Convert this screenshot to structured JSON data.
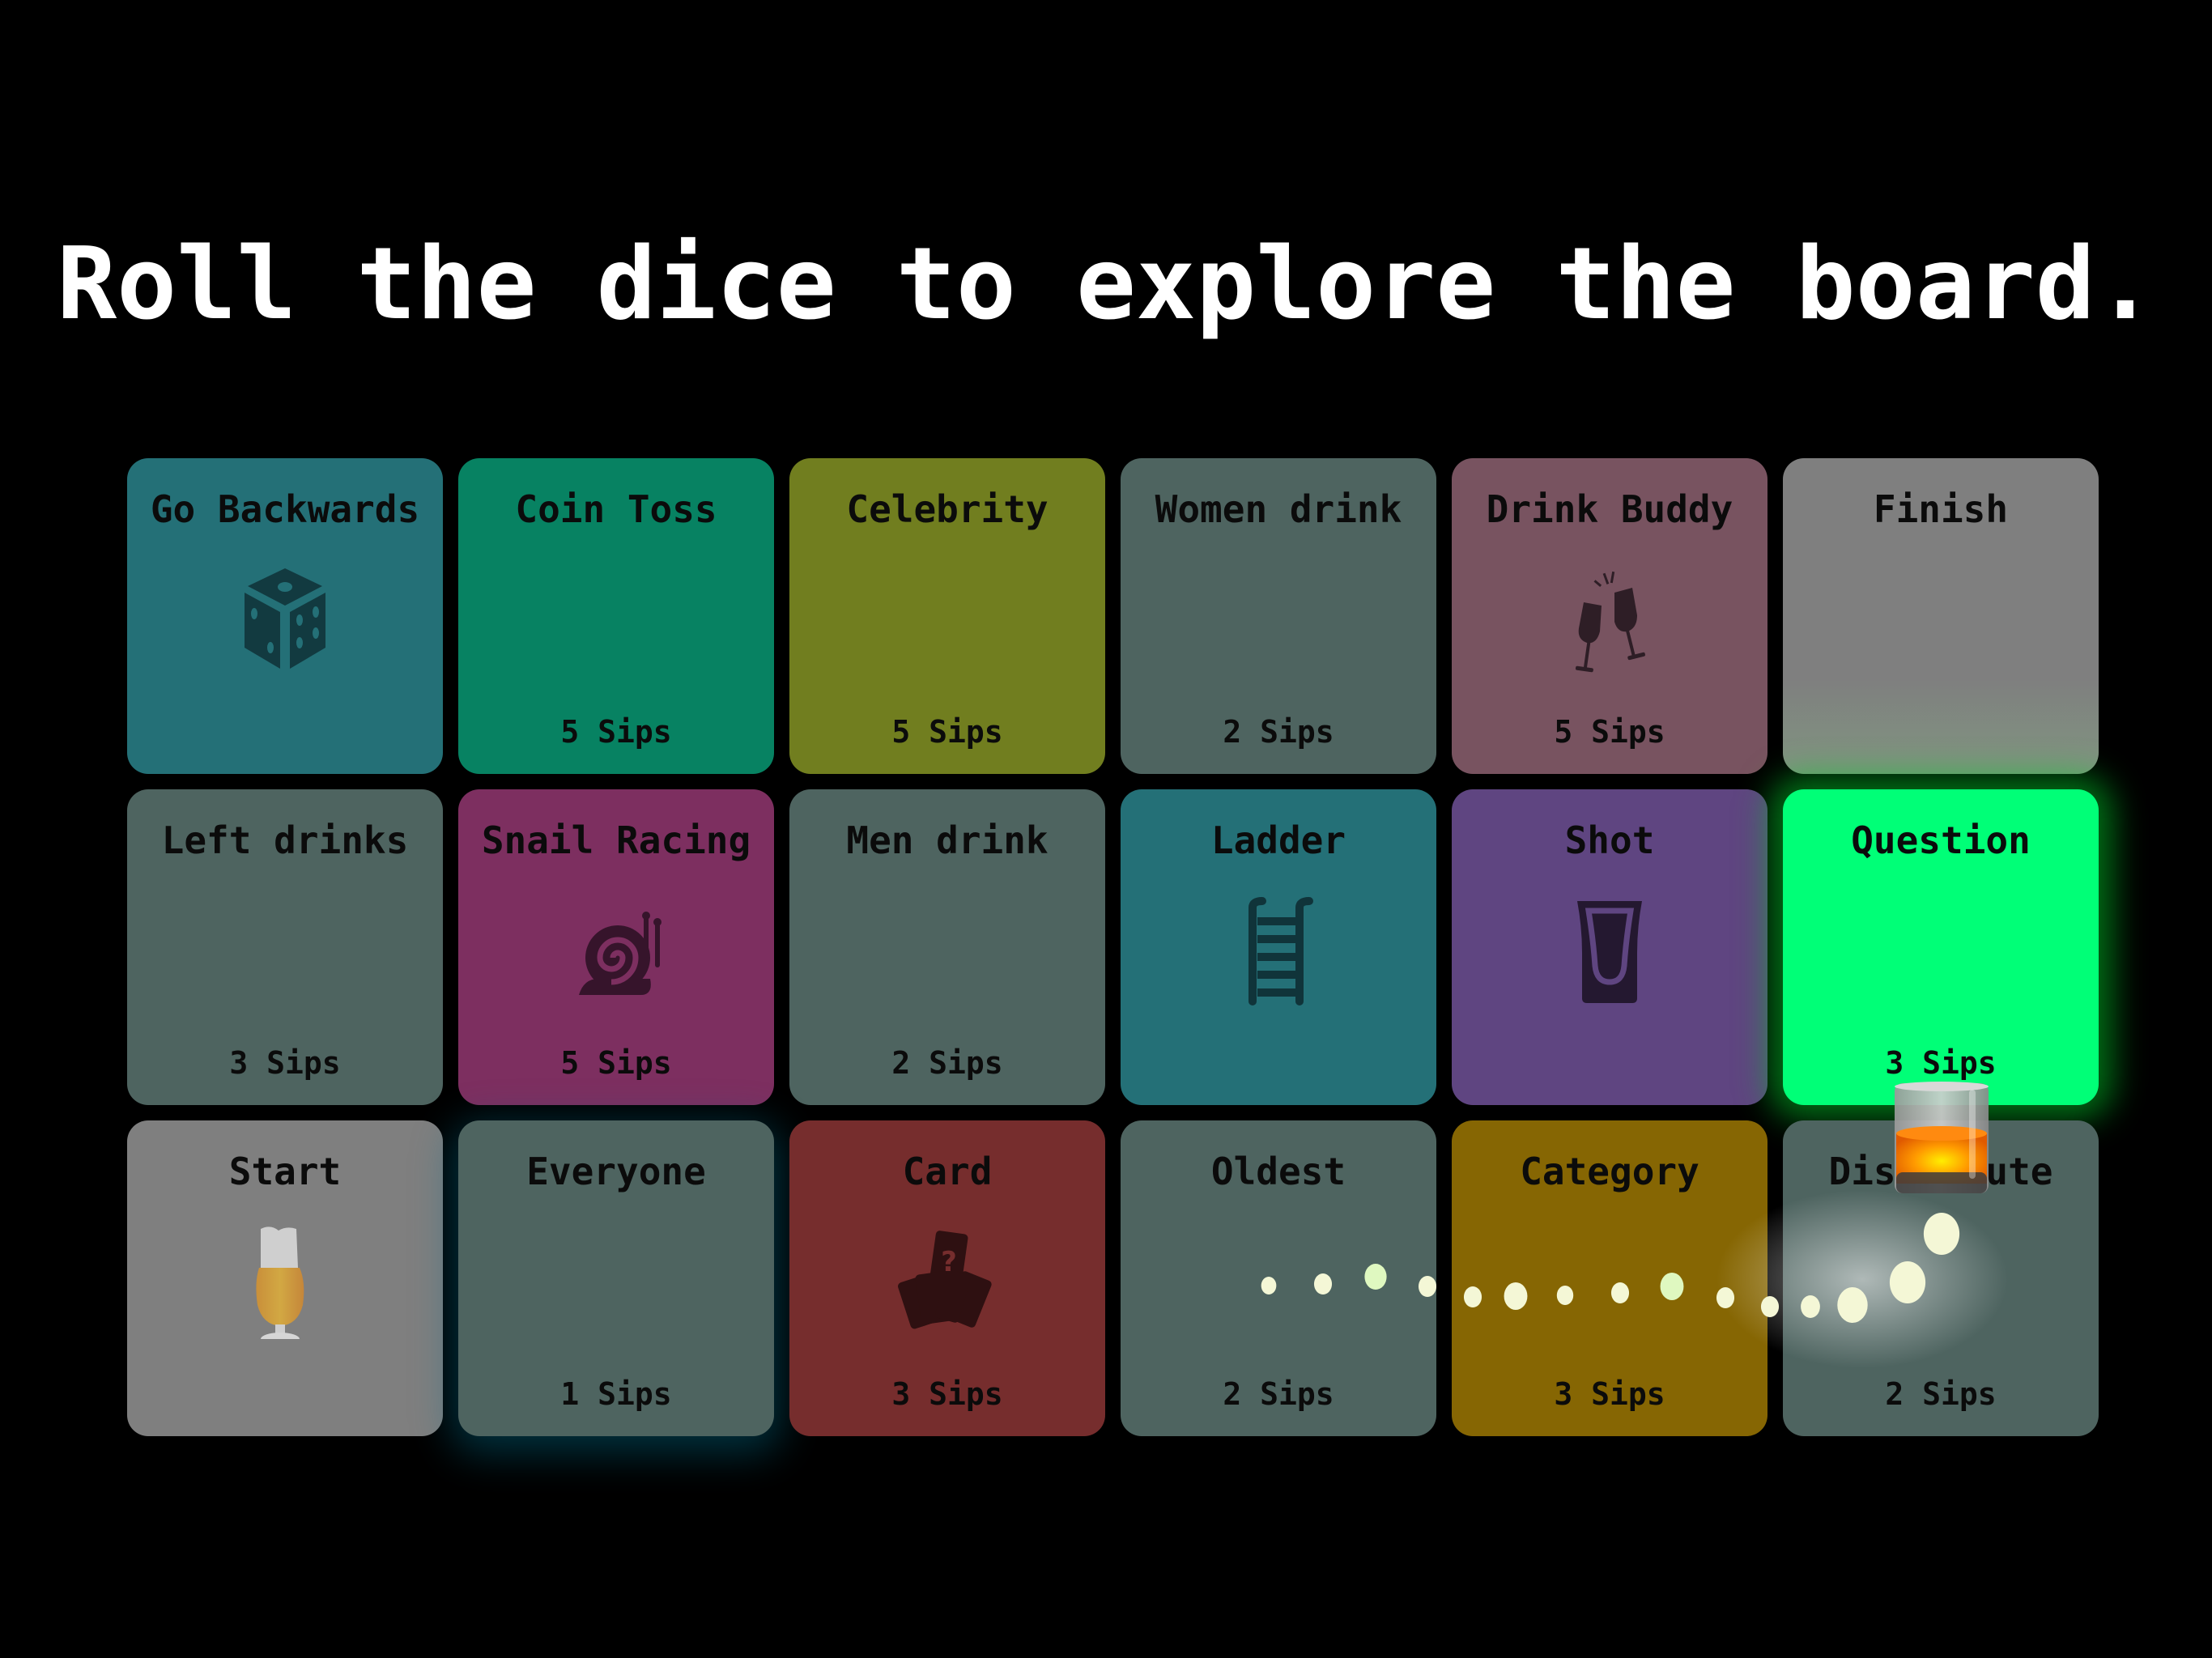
{
  "header": {
    "title": "Roll the dice to explore the board."
  },
  "board": {
    "rows": [
      [
        {
          "label": "Go Backwards",
          "sips": "",
          "color": "#247077",
          "icon": "dice-icon"
        },
        {
          "label": "Coin Toss",
          "sips": "5 Sips",
          "color": "#078262",
          "icon": ""
        },
        {
          "label": "Celebrity",
          "sips": "5 Sips",
          "color": "#717e1f",
          "icon": ""
        },
        {
          "label": "Women drink",
          "sips": "2 Sips",
          "color": "#4e6460",
          "icon": ""
        },
        {
          "label": "Drink Buddy",
          "sips": "5 Sips",
          "color": "#785360",
          "icon": "champagne-toast-icon"
        },
        {
          "label": "Finish",
          "sips": "",
          "color": "#7f7f7f",
          "icon": ""
        }
      ],
      [
        {
          "label": "Left drinks",
          "sips": "3 Sips",
          "color": "#4e6460",
          "icon": ""
        },
        {
          "label": "Snail Racing",
          "sips": "5 Sips",
          "color": "#7d2f60",
          "icon": "snail-icon"
        },
        {
          "label": "Men drink",
          "sips": "2 Sips",
          "color": "#4e6460",
          "icon": ""
        },
        {
          "label": "Ladder",
          "sips": "",
          "color": "#247077",
          "icon": "ladder-icon"
        },
        {
          "label": "Shot",
          "sips": "",
          "color": "#5f4581",
          "icon": "shot-glass-icon"
        },
        {
          "label": "Question",
          "sips": "3 Sips",
          "color": "#00ff77",
          "icon": "",
          "active": true
        }
      ],
      [
        {
          "label": "Start",
          "sips": "",
          "color": "#7f7f7f",
          "icon": "beer-glass-icon"
        },
        {
          "label": "Everyone",
          "sips": "1 Sips",
          "color": "#4e6460",
          "icon": ""
        },
        {
          "label": "Card",
          "sips": "3 Sips",
          "color": "#762d2d",
          "icon": "cards-icon"
        },
        {
          "label": "Oldest",
          "sips": "2 Sips",
          "color": "#4e6460",
          "icon": ""
        },
        {
          "label": "Category",
          "sips": "3 Sips",
          "color": "#866603",
          "icon": ""
        },
        {
          "label": "Distribute",
          "sips": "2 Sips",
          "color": "#4e6460",
          "icon": ""
        }
      ]
    ]
  },
  "player": {
    "token": "whiskey-glass-icon",
    "current_tile": "Question"
  },
  "colors": {
    "background": "#000000",
    "title": "#ffffff",
    "active_tile": "#00ff77",
    "trail": "#f4f7d6",
    "trail_accent": "#dff8c0"
  }
}
